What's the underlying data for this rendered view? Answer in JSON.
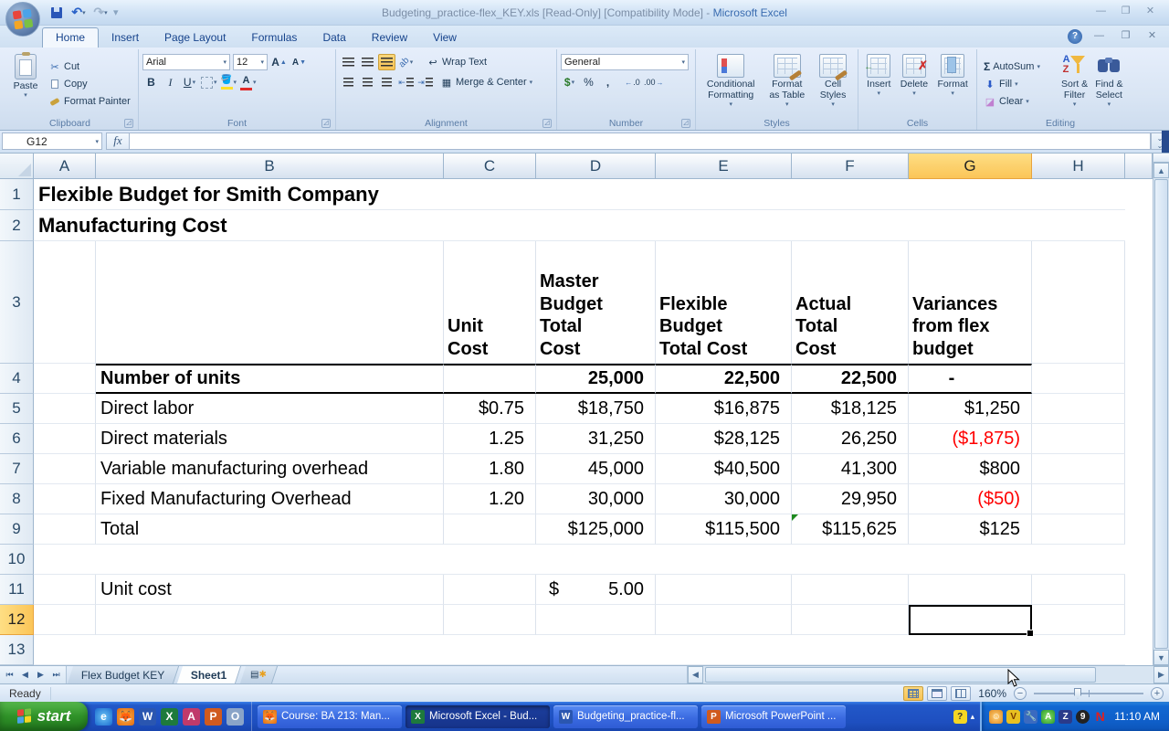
{
  "title_bar": {
    "doc_title": "Budgeting_practice-flex_KEY.xls  [Read-Only]  [Compatibility Mode] -",
    "app_name": "Microsoft Excel"
  },
  "ribbon_tabs": [
    {
      "label": "Home"
    },
    {
      "label": "Insert"
    },
    {
      "label": "Page Layout"
    },
    {
      "label": "Formulas"
    },
    {
      "label": "Data"
    },
    {
      "label": "Review"
    },
    {
      "label": "View"
    }
  ],
  "ribbon": {
    "clipboard": {
      "paste": "Paste",
      "cut": "Cut",
      "copy": "Copy",
      "format_painter": "Format Painter",
      "label": "Clipboard"
    },
    "font": {
      "family": "Arial",
      "size": "12",
      "bold": "B",
      "italic": "I",
      "underline": "U",
      "label": "Font"
    },
    "alignment": {
      "wrap": "Wrap Text",
      "merge": "Merge & Center",
      "label": "Alignment"
    },
    "number": {
      "format": "General",
      "currency": "$",
      "percent": "%",
      "comma": ",",
      "inc_dec": ".0",
      "dec_dec": ".00",
      "label": "Number"
    },
    "styles": {
      "conditional": "Conditional\nFormatting",
      "table": "Format\nas Table",
      "cell": "Cell\nStyles",
      "label": "Styles"
    },
    "cells": {
      "insert": "Insert",
      "delete": "Delete",
      "format": "Format",
      "label": "Cells"
    },
    "editing": {
      "autosum": "AutoSum",
      "fill": "Fill",
      "clear": "Clear",
      "sort": "Sort &\nFilter",
      "find": "Find &\nSelect",
      "label": "Editing"
    }
  },
  "formula_bar": {
    "name_box": "G12",
    "fx_label": "fx",
    "content": ""
  },
  "sheet": {
    "col_headers": [
      "A",
      "B",
      "C",
      "D",
      "E",
      "F",
      "G",
      "H"
    ],
    "row_headers": [
      "1",
      "2",
      "3",
      "4",
      "5",
      "6",
      "7",
      "8",
      "9",
      "10",
      "11",
      "12",
      "13"
    ],
    "title1": "Flexible Budget for Smith Company",
    "title2": "Manufacturing Cost",
    "col_titles": {
      "c": "Unit\nCost",
      "d": "Master\nBudget\nTotal\nCost",
      "e": "Flexible\nBudget\nTotal Cost",
      "f": "Actual\nTotal\nCost",
      "g": "Variances\nfrom flex\nbudget"
    },
    "data": [
      {
        "b": "Number of units",
        "c": "",
        "d": "25,000",
        "e": "22,500",
        "f": "22,500",
        "g": "-"
      },
      {
        "b": "Direct labor",
        "c": "$0.75",
        "d": "$18,750",
        "e": "$16,875",
        "f": "$18,125",
        "g": "$1,250"
      },
      {
        "b": "Direct materials",
        "c": "1.25",
        "d": "31,250",
        "e": "$28,125",
        "f": "26,250",
        "g": "($1,875)"
      },
      {
        "b": "Variable manufacturing overhead",
        "c": "1.80",
        "d": "45,000",
        "e": "$40,500",
        "f": "41,300",
        "g": "$800"
      },
      {
        "b": "Fixed Manufacturing Overhead",
        "c": "1.20",
        "d": "30,000",
        "e": "30,000",
        "f": "29,950",
        "g": "($50)"
      },
      {
        "b": "Total",
        "c": "",
        "d": "$125,000",
        "e": "$115,500",
        "f": "$115,625",
        "g": "$125"
      }
    ],
    "unit_cost_label": "Unit cost",
    "unit_cost_symbol": "$",
    "unit_cost_value": "5.00",
    "selected_cell": "G12"
  },
  "sheet_tabs": {
    "tab1": "Flex Budget KEY",
    "tab2": "Sheet1"
  },
  "status_bar": {
    "mode": "Ready",
    "zoom_level": "160%"
  },
  "taskbar": {
    "start_label": "start",
    "tasks": [
      {
        "label": "Course: BA 213: Man..."
      },
      {
        "label": "Microsoft Excel - Bud..."
      },
      {
        "label": "Budgeting_practice-fl..."
      },
      {
        "label": "Microsoft PowerPoint ..."
      }
    ],
    "clock": "11:10 AM"
  },
  "colors": {
    "selection_highlight": "#fbc558",
    "negative_value": "#ff0000",
    "taskbar_blue": "#1e4fc0",
    "start_green": "#2f9128"
  }
}
